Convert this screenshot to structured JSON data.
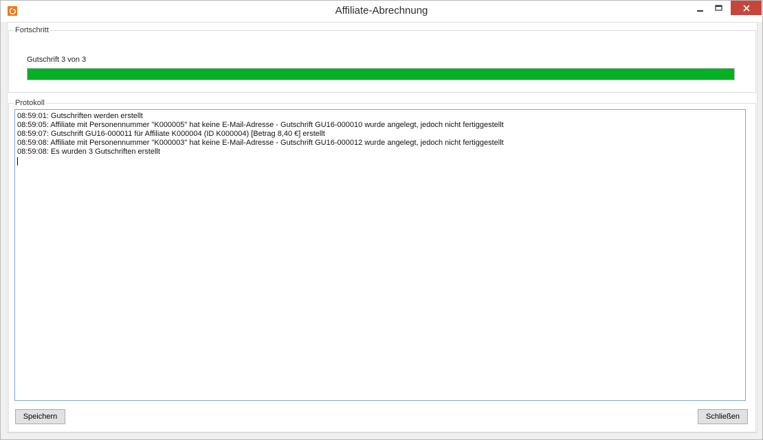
{
  "window": {
    "title": "Affiliate-Abrechnung",
    "icon": "app-logo-icon",
    "controls": [
      "minimize-icon",
      "maximize-icon",
      "close-icon"
    ]
  },
  "progress_group": {
    "legend": "Fortschritt",
    "label": "Gutschrift 3 von 3",
    "value_percent": 100,
    "bar_color": "#06b025"
  },
  "log_group": {
    "legend": "Protokoll",
    "lines": [
      "08:59:01: Gutschriften werden erstellt",
      "08:59:05: Affiliate mit Personennummer \"K000005\" hat keine E-Mail-Adresse - Gutschrift GU16-000010 wurde angelegt, jedoch nicht fertiggestellt",
      "08:59:07: Gutschrift GU16-000011 für Affiliate K000004 (ID K000004) [Betrag 8,40 €] erstellt",
      "08:59:08: Affiliate mit Personennummer \"K000003\" hat keine E-Mail-Adresse - Gutschrift GU16-000012 wurde angelegt, jedoch nicht fertiggestellt",
      "08:59:08: Es wurden 3 Gutschriften erstellt"
    ]
  },
  "buttons": {
    "save_label": "Speichern",
    "close_label": "Schließen"
  },
  "colors": {
    "close_button": "#c7463b",
    "app_icon": "#f07814",
    "log_border": "#7aa7d7"
  }
}
